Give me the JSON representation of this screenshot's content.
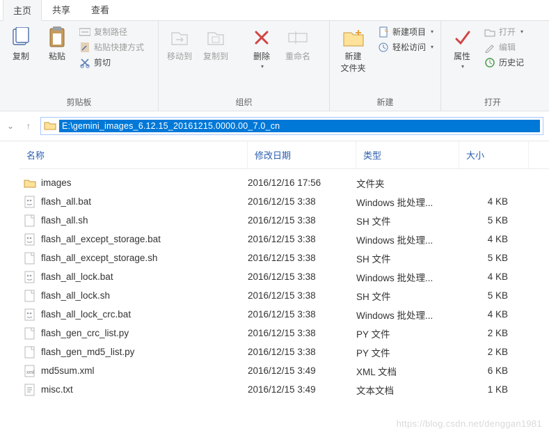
{
  "tabs": {
    "home": "主页",
    "share": "共享",
    "view": "查看"
  },
  "ribbon": {
    "clipboard": {
      "title": "剪贴板",
      "copy": "复制",
      "paste": "粘贴",
      "copy_path": "复制路径",
      "paste_shortcut": "粘贴快捷方式",
      "cut": "剪切"
    },
    "organize": {
      "title": "组织",
      "move_to": "移动到",
      "copy_to": "复制到",
      "delete": "删除",
      "rename": "重命名"
    },
    "new": {
      "title": "新建",
      "new_folder": "新建\n文件夹",
      "new_item": "新建项目",
      "easy_access": "轻松访问"
    },
    "open": {
      "title": "打开",
      "properties": "属性",
      "open": "打开",
      "edit": "编辑",
      "history": "历史记"
    }
  },
  "address": "E:\\gemini_images_6.12.15_20161215.0000.00_7.0_cn",
  "columns": {
    "name": "名称",
    "date": "修改日期",
    "type": "类型",
    "size": "大小"
  },
  "files": [
    {
      "icon": "folder",
      "name": "images",
      "date": "2016/12/16 17:56",
      "type": "文件夹",
      "size": ""
    },
    {
      "icon": "bat",
      "name": "flash_all.bat",
      "date": "2016/12/15 3:38",
      "type": "Windows 批处理...",
      "size": "4 KB"
    },
    {
      "icon": "file",
      "name": "flash_all.sh",
      "date": "2016/12/15 3:38",
      "type": "SH 文件",
      "size": "5 KB"
    },
    {
      "icon": "bat",
      "name": "flash_all_except_storage.bat",
      "date": "2016/12/15 3:38",
      "type": "Windows 批处理...",
      "size": "4 KB"
    },
    {
      "icon": "file",
      "name": "flash_all_except_storage.sh",
      "date": "2016/12/15 3:38",
      "type": "SH 文件",
      "size": "5 KB"
    },
    {
      "icon": "bat",
      "name": "flash_all_lock.bat",
      "date": "2016/12/15 3:38",
      "type": "Windows 批处理...",
      "size": "4 KB"
    },
    {
      "icon": "file",
      "name": "flash_all_lock.sh",
      "date": "2016/12/15 3:38",
      "type": "SH 文件",
      "size": "5 KB"
    },
    {
      "icon": "bat",
      "name": "flash_all_lock_crc.bat",
      "date": "2016/12/15 3:38",
      "type": "Windows 批处理...",
      "size": "4 KB"
    },
    {
      "icon": "file",
      "name": "flash_gen_crc_list.py",
      "date": "2016/12/15 3:38",
      "type": "PY 文件",
      "size": "2 KB"
    },
    {
      "icon": "file",
      "name": "flash_gen_md5_list.py",
      "date": "2016/12/15 3:38",
      "type": "PY 文件",
      "size": "2 KB"
    },
    {
      "icon": "xml",
      "name": "md5sum.xml",
      "date": "2016/12/15 3:49",
      "type": "XML 文档",
      "size": "6 KB"
    },
    {
      "icon": "txt",
      "name": "misc.txt",
      "date": "2016/12/15 3:49",
      "type": "文本文档",
      "size": "1 KB"
    }
  ],
  "watermark": "https://blog.csdn.net/denggan1981"
}
